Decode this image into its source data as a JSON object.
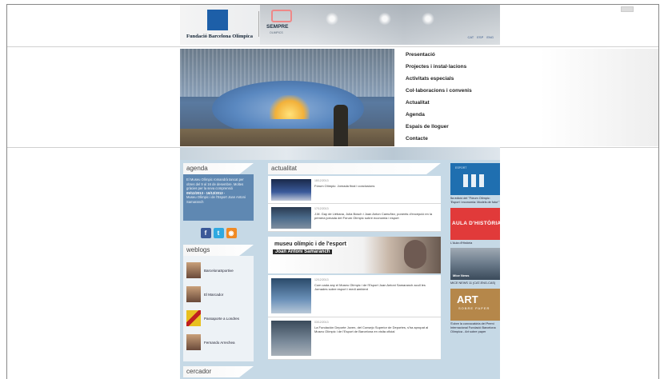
{
  "header": {
    "org_name": "Fundació Barcelona Olímpica",
    "sempre_label": "SEMPRE",
    "sempre_sub": "OLIMPICS",
    "languages": [
      "CAT",
      "ESP",
      "ENG"
    ]
  },
  "nav": {
    "items": [
      "Presentació",
      "Projectes i instal·lacions",
      "Activitats especials",
      "Col·laboracions i convenis",
      "Actualitat",
      "Agenda",
      "Espais de lloguer",
      "Contacte"
    ]
  },
  "agenda": {
    "title": "agenda",
    "text1": "El Museu Olímpic romandrà tancat per obres del 9 al 16 de desembre. Moltes gràcies per la seva comprensió",
    "dates": "09/12/2013 - 16/12/2013 -",
    "text2": "Museu Olímpic i de l'Esport Joan Antoni Samaranch"
  },
  "social": {
    "facebook": "f",
    "twitter": "t",
    "rss": "rss"
  },
  "weblogs": {
    "title": "weblogs",
    "items": [
      "BarcelonaSportive",
      "El Marcador",
      "Passaporte a Londres",
      "Fernando Arrechea"
    ]
  },
  "cercador": {
    "title": "cercador"
  },
  "actualitat": {
    "title": "actualitat",
    "news": [
      {
        "date": "18/12/2013",
        "text": "Fòrum Olímpic: Jornada final i conclusions"
      },
      {
        "date": "17/12/2013",
        "text": "J.M. Gay de Liébana, Julia Bosch i Joan Anton Camuñez, ponents d'excepció en la primera jornada del Fòrum Olímpic sobre economia i esport"
      }
    ],
    "museum_title": "museu olímpic i de l'esport",
    "museum_sub": "Joan Antoni Samaranch",
    "museum_news": [
      {
        "date": "12/12/2013",
        "text": "Com cada any el Museu Olímpic i de l'Esport Joan Antoni Samaranch acull les Jornades sobre esport i medi ambient"
      },
      {
        "date": "03/12/2013",
        "text": "La Fundación Deporte Joven, del Consejo Superior de Deportes, s'ha apropat al Museu Olímpic i de l'Esport de Barcelona en visita oficial"
      }
    ]
  },
  "right_promos": [
    {
      "label": "ESPORT",
      "caption": "5a edició del \"Fòrum Olímpic: 'Esport i economia: Models de futur'\""
    },
    {
      "label": "AULA D'HISTÒRIA",
      "caption": "L'Aula d'Història"
    },
    {
      "label": "Mice News",
      "caption": "MICE NEWS 11 (CAT-ENG-CAS)"
    },
    {
      "label": "ART",
      "sub": "SOBRE PAPER",
      "caption": "S'obre la convocatòria del Premi Internacional Fundació Barcelona Olímpica - Art sobre paper"
    }
  ],
  "colors": {
    "content_bg": "#c6d9e6",
    "agenda_bg": "#5f88b2",
    "aula_red": "#e13a3a",
    "esport_blue": "#1f6fb0"
  }
}
